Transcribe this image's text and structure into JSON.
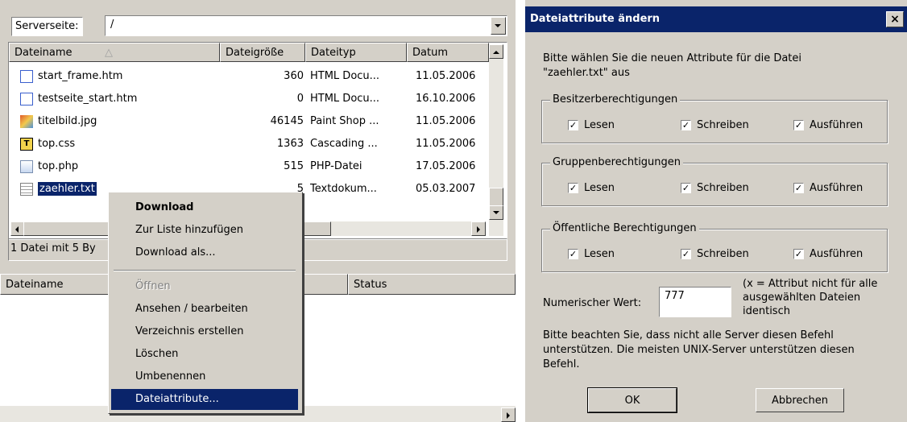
{
  "left_panel": {
    "server_label": "Serverseite:",
    "server_path": "/",
    "columns": [
      "Dateiname",
      "Dateigröße",
      "Dateityp",
      "Datum"
    ],
    "files": [
      {
        "name": "start_frame.htm",
        "size": "360",
        "type": "HTML Docu...",
        "date": "11.05.2006",
        "icon": "html-file-icon"
      },
      {
        "name": "testseite_start.htm",
        "size": "0",
        "type": "HTML Docu...",
        "date": "16.10.2006",
        "icon": "html-file-icon"
      },
      {
        "name": "titelbild.jpg",
        "size": "46145",
        "type": "Paint Shop ...",
        "date": "11.05.2006",
        "icon": "image-file-icon"
      },
      {
        "name": "top.css",
        "size": "1363",
        "type": "Cascading ...",
        "date": "11.05.2006",
        "icon": "css-file-icon"
      },
      {
        "name": "top.php",
        "size": "515",
        "type": "PHP-Datei",
        "date": "17.05.2006",
        "icon": "php-file-icon"
      },
      {
        "name": "zaehler.txt",
        "size": "5",
        "type": "Textdokum...",
        "date": "05.03.2007",
        "icon": "text-file-icon"
      }
    ],
    "status_text": "1 Datei mit 5 By",
    "queue_columns": [
      "Dateiname",
      "Status"
    ]
  },
  "context_menu": {
    "items": [
      {
        "label": "Download",
        "bold": true
      },
      {
        "label": "Zur Liste hinzufügen"
      },
      {
        "label": "Download als..."
      },
      {
        "label": "Öffnen",
        "disabled": true
      },
      {
        "label": "Ansehen / bearbeiten"
      },
      {
        "label": "Verzeichnis erstellen"
      },
      {
        "label": "Löschen"
      },
      {
        "label": "Umbenennen"
      },
      {
        "label": "Dateiattribute...",
        "active": true
      }
    ]
  },
  "dialog": {
    "title": "Dateiattribute ändern",
    "close_glyph": "×",
    "intro_line1": "Bitte wählen Sie die neuen Attribute für die Datei",
    "intro_line2": "\"zaehler.txt\" aus",
    "groups": [
      {
        "label": "Besitzerberechtigungen"
      },
      {
        "label": "Gruppenberechtigungen"
      },
      {
        "label": "Öffentliche Berechtigungen"
      }
    ],
    "perm_read": "Lesen",
    "perm_write": "Schreiben",
    "perm_exec": "Ausführen",
    "check_glyph": "✓",
    "numeric_label": "Numerischer Wert:",
    "numeric_value": "777",
    "note_line1": "(x = Attribut nicht für alle",
    "note_line2": "ausgewählten Dateien",
    "note_line3": "identisch",
    "warn_line1": "Bitte beachten Sie, dass nicht alle Server diesen Befehl",
    "warn_line2": "unterstützen. Die meisten UNIX-Server unterstützen diesen",
    "warn_line3": "Befehl.",
    "ok_label": "OK",
    "cancel_label": "Abbrechen"
  }
}
